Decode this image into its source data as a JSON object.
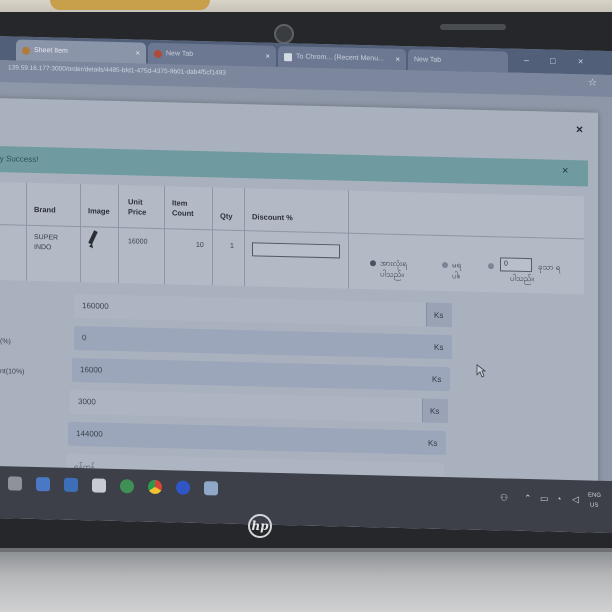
{
  "browser": {
    "tabs": [
      {
        "label": "Sheet Item",
        "active": true
      },
      {
        "label": "New Tab",
        "active": false
      },
      {
        "label": "To Chrom... (Recent Menu...",
        "active": false
      },
      {
        "label": "New Tab",
        "active": false
      }
    ],
    "url": "139.59.16.177:3000/order/details/4485-bfd1-475d-4375-9b01-dab4f5cf1493"
  },
  "modal": {
    "alert_text": "ly Success!",
    "table": {
      "headers": [
        "Brand",
        "Image",
        "Unit Price",
        "Item Count",
        "Qty",
        "Discount %"
      ],
      "row": {
        "brand": "SUPER INDO",
        "unit_price": "16000",
        "item_count": "10",
        "qty": "1",
        "discount_input": ""
      },
      "options": {
        "option1_line1": "အားလုံးရ",
        "option1_line2": "ပါသည်။",
        "option2_line1": "မရ",
        "option2_line2": "ပါ။",
        "option3_value": "0",
        "option3_line1": "ခုသာ ရ",
        "option3_line2": "ပါသည်။"
      }
    },
    "summary": {
      "labels": [
        "(%)",
        "nt(10%)"
      ],
      "unit": "Ks",
      "fields": [
        "160000",
        "0",
        "16000",
        "3000",
        "144000",
        "ရန်ကုန်"
      ]
    }
  },
  "taskbar": {
    "lang": "ENG",
    "region": "US"
  },
  "laptop": {
    "brand": "hp"
  }
}
